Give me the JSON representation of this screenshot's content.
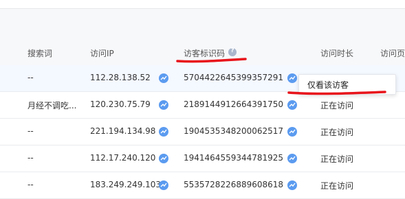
{
  "table": {
    "headers": {
      "search_term": "搜索词",
      "ip": "访问IP",
      "visitor_id": "访客标识码",
      "duration": "访问时长",
      "page": "访问页"
    },
    "rows": [
      {
        "search_term": "--",
        "ip": "112.28.138.52",
        "visitor_id": "5704422645399357291",
        "duration": ""
      },
      {
        "search_term": "月经不调吃...",
        "ip": "120.230.75.79",
        "visitor_id": "2189144912664391750",
        "duration": "正在访问"
      },
      {
        "search_term": "--",
        "ip": "221.194.134.98",
        "visitor_id": "1904535348200062517",
        "duration": "正在访问"
      },
      {
        "search_term": "--",
        "ip": "112.17.240.120",
        "visitor_id": "1941464559344781925",
        "duration": "正在访问"
      },
      {
        "search_term": "--",
        "ip": "183.249.249.103",
        "visitor_id": "5535728226889608618",
        "duration": "正在访问"
      }
    ]
  },
  "popup": {
    "label": "仅看该访客"
  },
  "colors": {
    "accent": "#5b9bf0",
    "annotation": "#e8141b"
  }
}
